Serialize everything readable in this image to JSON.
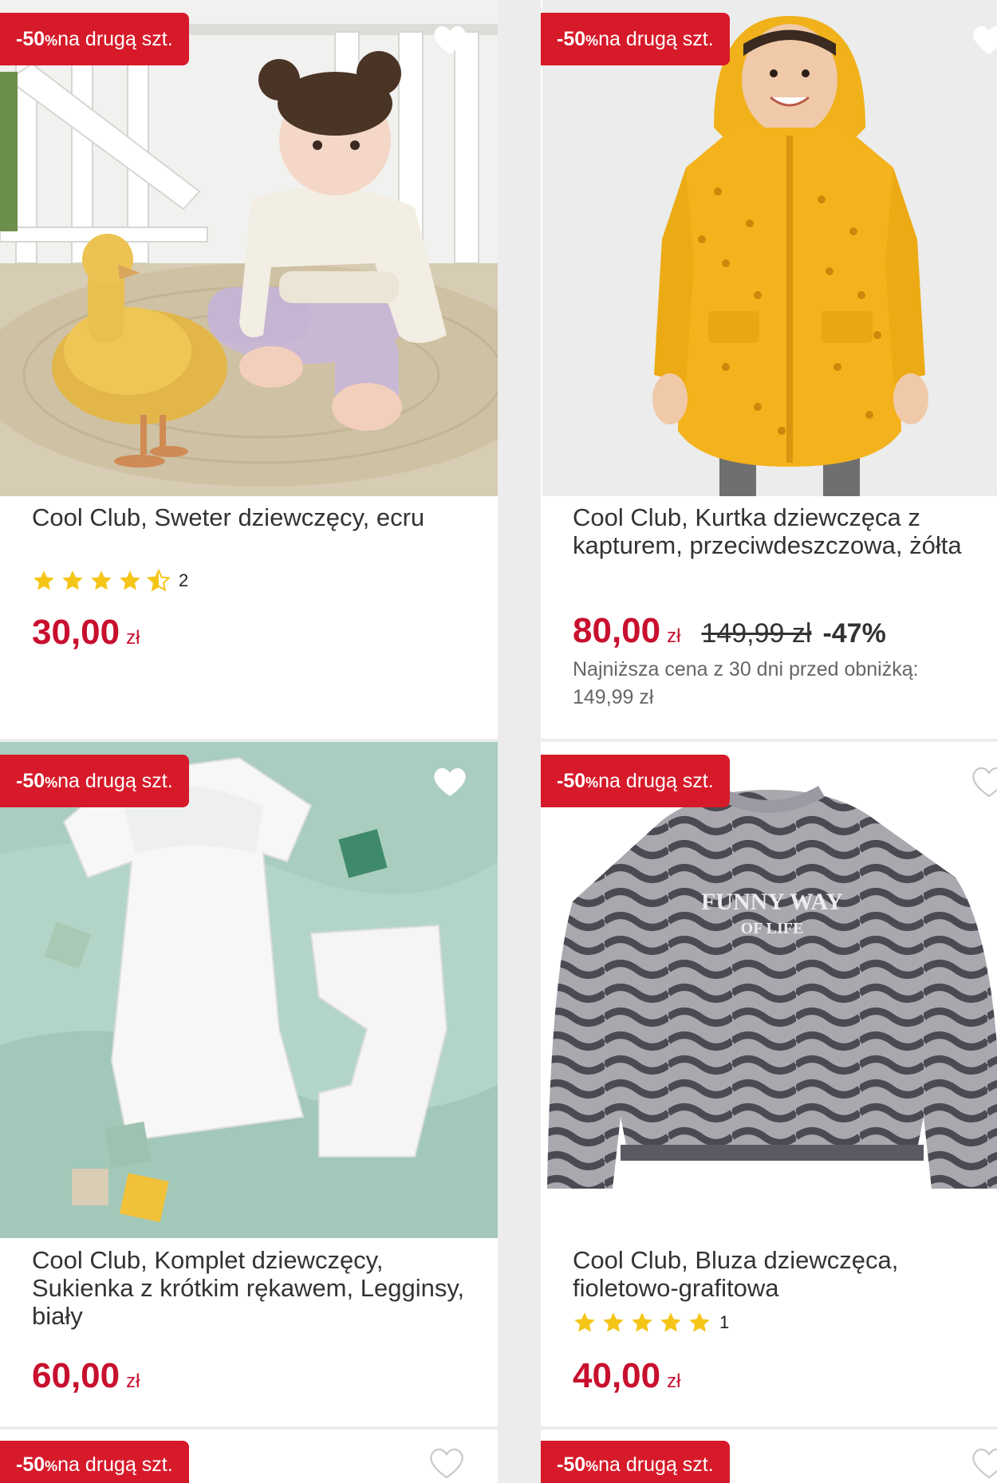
{
  "promo": {
    "percent": "-50",
    "percent_sign": "%",
    "text": " na drugą szt."
  },
  "products": [
    {
      "title": "Cool Club, Sweter dziewczęcy, ecru",
      "rating": 4.5,
      "rating_count": "2",
      "price": "30,00",
      "currency": "zł"
    },
    {
      "title": "Cool Club, Kurtka dziewczęca z kapturem, przeciwdeszczowa, żółta",
      "price": "80,00",
      "currency": "zł",
      "old_price": "149,99 zł",
      "discount": "-47%",
      "lowest_price_note": "Najniższa cena z 30 dni przed obniżką: 149,99 zł"
    },
    {
      "title": "Cool Club, Komplet dziewczęcy, Sukienka z krótkim rękawem, Legginsy, biały",
      "price": "60,00",
      "currency": "zł"
    },
    {
      "title": "Cool Club, Bluza dziewczęca, fioletowo-grafitowa",
      "rating": 5,
      "rating_count": "1",
      "price": "40,00",
      "currency": "zł",
      "print_text_line1": "FUNNY WAY",
      "print_text_line2": "OF LIFE"
    }
  ],
  "colors": {
    "accent": "#d71a2a",
    "price": "#c8102e",
    "star": "#f5c518"
  }
}
